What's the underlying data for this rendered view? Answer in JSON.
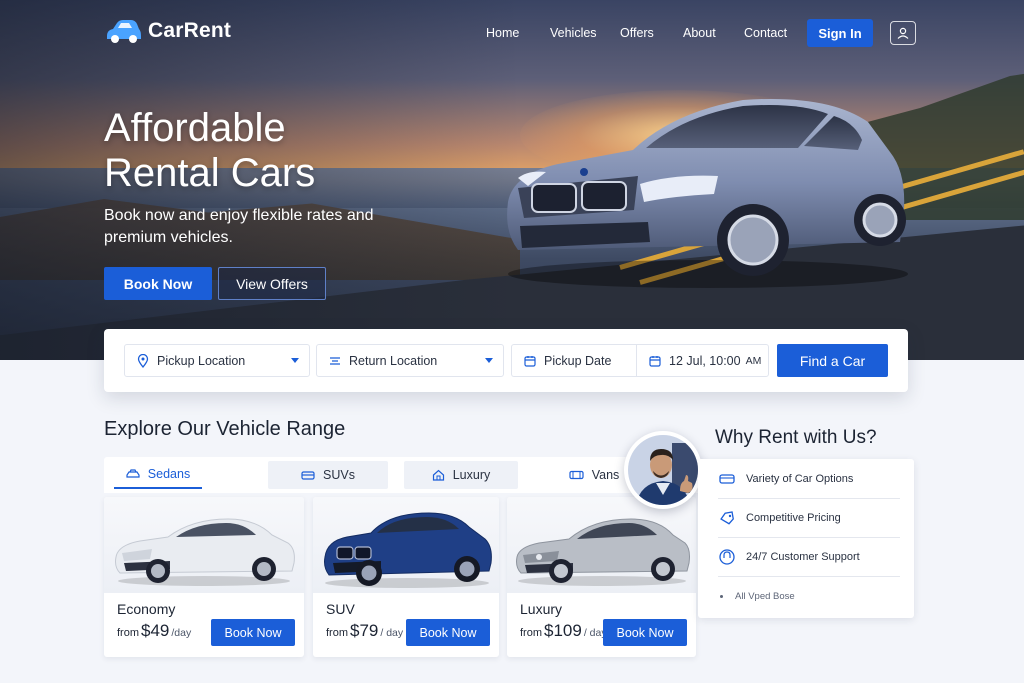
{
  "brand": {
    "name": "CarRent"
  },
  "nav": {
    "items": [
      "Home",
      "Vehicles",
      "Offers",
      "About",
      "Contact"
    ],
    "signin_label": "Sign In",
    "user_icon": "user-icon"
  },
  "hero": {
    "title_line1": "Affordable",
    "title_line2": "Rental Cars",
    "subtitle": "Book now and enjoy flexible rates and premium vehicles.",
    "primary_button": "Book Now",
    "secondary_button": "View Offers"
  },
  "search": {
    "pickup_location": "Pickup Location",
    "return_location": "Return Location",
    "pickup_date": "Pickup Date",
    "datetime_value": "12 Jul, 10:00",
    "datetime_ampm": "AM",
    "find_button": "Find a Car"
  },
  "range": {
    "title": "Explore Our Vehicle Range",
    "tabs": [
      {
        "label": "Sedans",
        "icon": "sedan-icon",
        "active": true
      },
      {
        "label": "SUVs",
        "icon": "suv-icon",
        "active": false
      },
      {
        "label": "Luxury",
        "icon": "home-icon",
        "active": false
      },
      {
        "label": "Vans",
        "icon": "van-icon",
        "active": false
      }
    ],
    "cards": [
      {
        "name": "Economy",
        "from": "from",
        "price": "$49",
        "per": "/day",
        "button": "Book Now",
        "color": "#e9ecf1"
      },
      {
        "name": "SUV",
        "from": "from",
        "price": "$79",
        "per": "/ day",
        "button": "Book Now",
        "color": "#1f3f86"
      },
      {
        "name": "Luxury",
        "from": "from",
        "price": "$109",
        "per": "/ day",
        "button": "Book Now",
        "color": "#b9bec6"
      }
    ]
  },
  "why": {
    "title": "Why Rent with Us?",
    "items": [
      {
        "label": "Variety of Car Options",
        "icon": "car-icon"
      },
      {
        "label": "Competitive Pricing",
        "icon": "tag-icon"
      },
      {
        "label": "24/7 Customer Support",
        "icon": "support-icon"
      }
    ],
    "footnote": "All Vped Bose"
  },
  "colors": {
    "accent": "#1b5ed8",
    "text": "#1c2433",
    "page_bg": "#f3f5fa"
  }
}
